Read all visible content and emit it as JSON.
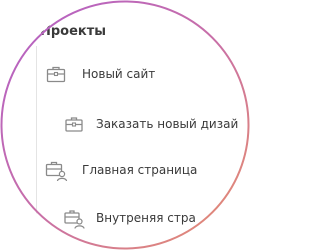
{
  "sidebar": {
    "heading": "Проекты",
    "items": [
      {
        "label": "Новый сайт",
        "icon": "briefcase-icon"
      },
      {
        "label": "Заказать новый дизай",
        "icon": "briefcase-icon"
      },
      {
        "label": "Главная страница",
        "icon": "briefcase-user-icon"
      },
      {
        "label": "Внутреняя стра",
        "icon": "briefcase-user-icon"
      }
    ]
  },
  "colors": {
    "ring_start": "#b25fc8",
    "ring_end": "#e8906a",
    "text": "#3a3a3a",
    "icon": "#8a8a8a"
  }
}
